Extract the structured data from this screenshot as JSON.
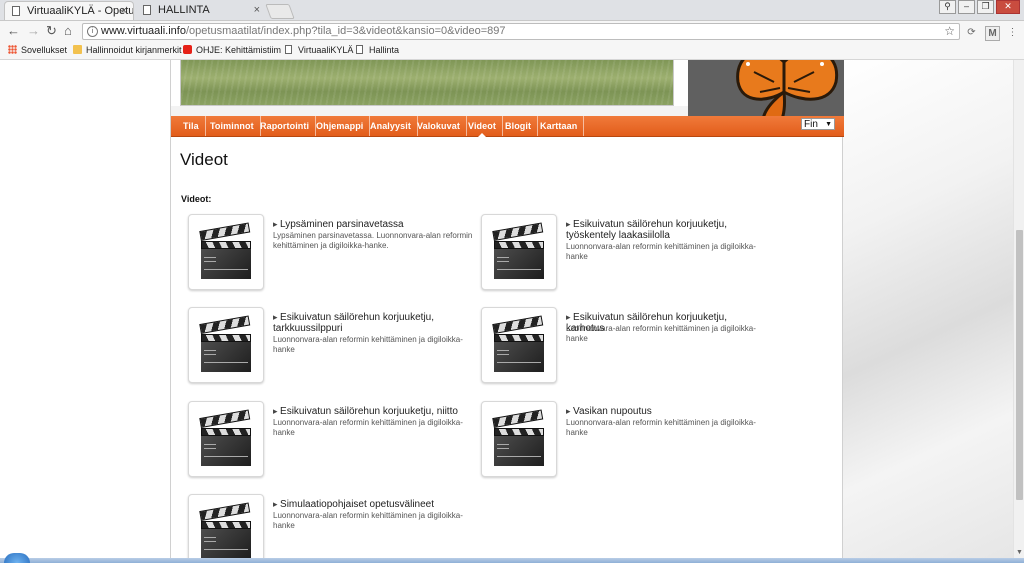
{
  "browser": {
    "tabs": [
      {
        "title": "VirtuaaliKYLÄ - Opetusm",
        "close": "×"
      },
      {
        "title": "HALLINTA",
        "close": "×"
      }
    ],
    "url_host": "www.virtuaali.info",
    "url_path": "/opetusmaatilat/index.php?tila_id=3&videot&kansio=0&video=897",
    "bookmarks": [
      "Sovellukset",
      "Hallinnoidut kirjanmerkit",
      "OHJE: Kehittämistiim",
      "VirtuaaliKYLÄ",
      "Hallinta"
    ]
  },
  "nav": {
    "items": [
      "Tila",
      "Toiminnot",
      "Raportointi",
      "Ohjemappi",
      "Analyysit",
      "Valokuvat",
      "Videot",
      "Blogit",
      "Karttaan"
    ],
    "active": "Videot",
    "language": "Fin"
  },
  "page": {
    "title": "Videot",
    "section_label": "Videot:"
  },
  "videos": [
    {
      "title": "Lypsäminen parsinavetassa",
      "desc": "Lypsäminen parsinavetassa. Luonnonvara-alan reformin kehittäminen ja digiloikka-hanke."
    },
    {
      "title": "Esikuivatun säilörehun korjuuketju, työskentely laakasiilolla",
      "desc": "Luonnonvara-alan reformin kehittäminen ja digiloikka-hanke"
    },
    {
      "title": "Esikuivatun säilörehun korjuuketju, tarkkuussilppuri",
      "desc": "Luonnonvara-alan reformin kehittäminen ja digiloikka-hanke"
    },
    {
      "title": "Esikuivatun säilörehun korjuuketju, karhotus",
      "desc": "Luonnonvara-alan reformin kehittäminen ja digiloikka-hanke"
    },
    {
      "title": "Esikuivatun säilörehun korjuuketju, niitto",
      "desc": "Luonnonvara-alan reformin kehittäminen ja digiloikka-hanke"
    },
    {
      "title": "Vasikan nupoutus",
      "desc": "Luonnonvara-alan reformin kehittäminen ja digiloikka-hanke"
    },
    {
      "title": "Simulaatiopohjaiset opetusvälineet",
      "desc": "Luonnonvara-alan reformin kehittäminen ja digiloikka-hanke"
    }
  ],
  "colors": {
    "nav_orange": "#e8672a",
    "text": "#222222"
  }
}
